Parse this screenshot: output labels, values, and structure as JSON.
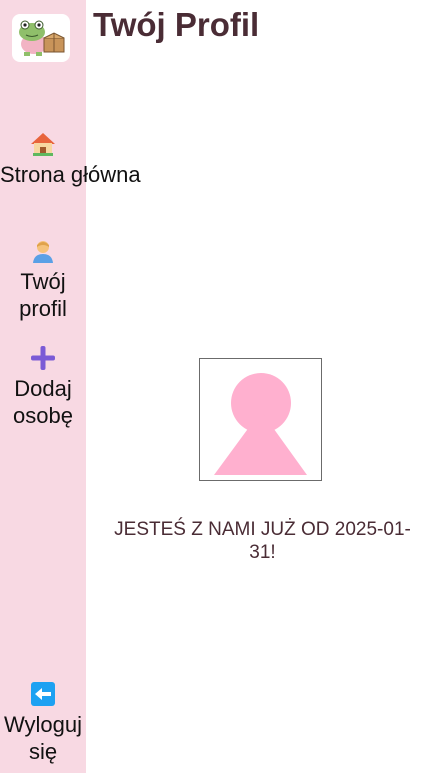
{
  "page": {
    "title": "Twój Profil"
  },
  "sidebar": {
    "logo_icon": "frog-with-box-logo",
    "items": [
      {
        "label": "Strona główna",
        "icon": "house-icon"
      },
      {
        "label": "Twój profil",
        "icon": "person-icon"
      },
      {
        "label": "Dodaj osobę",
        "icon": "plus-icon"
      }
    ],
    "logout": {
      "label": "Wyloguj się",
      "icon": "left-arrow-icon"
    }
  },
  "profile": {
    "avatar_icon": "default-avatar-icon",
    "member_since": "JESTEŚ Z NAMI JUŻ OD 2025-01-31!"
  },
  "colors": {
    "sidebar_bg": "#f8d9e3",
    "title_text": "#4a2c35",
    "avatar_pink": "#ffb0cf",
    "plus_purple": "#7b5bd6",
    "logout_blue": "#1da1f2"
  }
}
